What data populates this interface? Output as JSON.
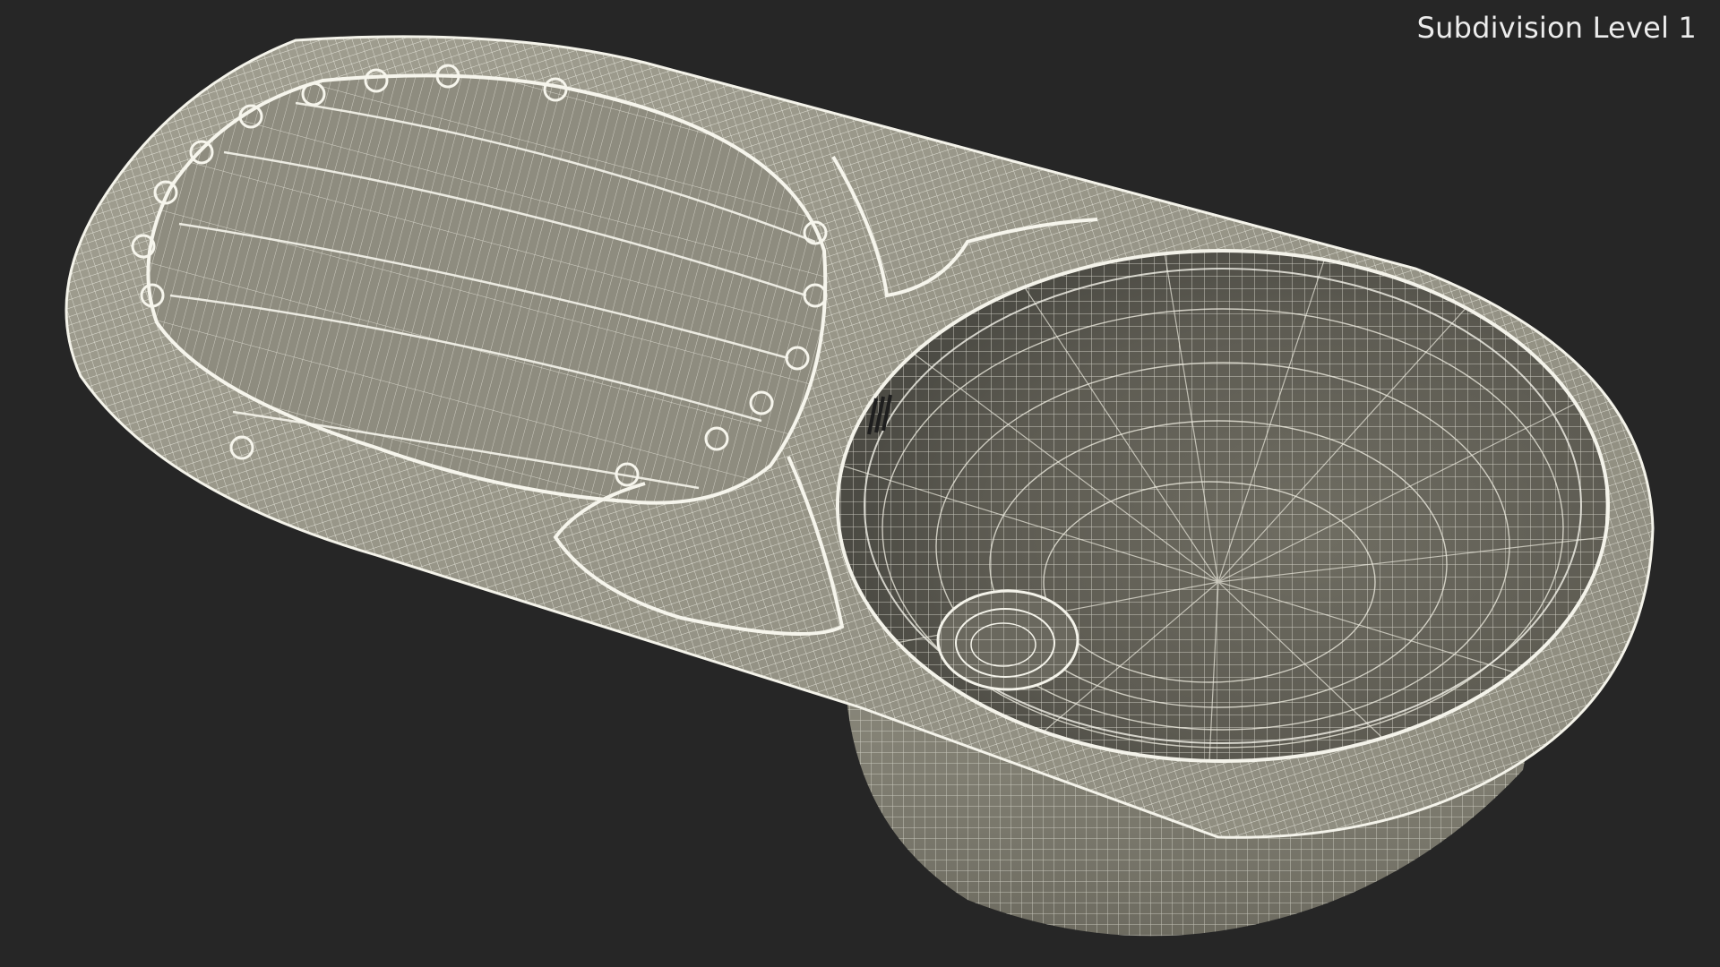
{
  "viewport": {
    "overlay_label": "Subdivision Level 1",
    "background_color": "#262626",
    "wire_color": "#f2f1e6",
    "surface_color": "#8c8a7c"
  },
  "model": {
    "object": "sink",
    "parts": [
      "drainboard",
      "bowl",
      "drain-hole",
      "overflow-slot",
      "rim"
    ]
  }
}
